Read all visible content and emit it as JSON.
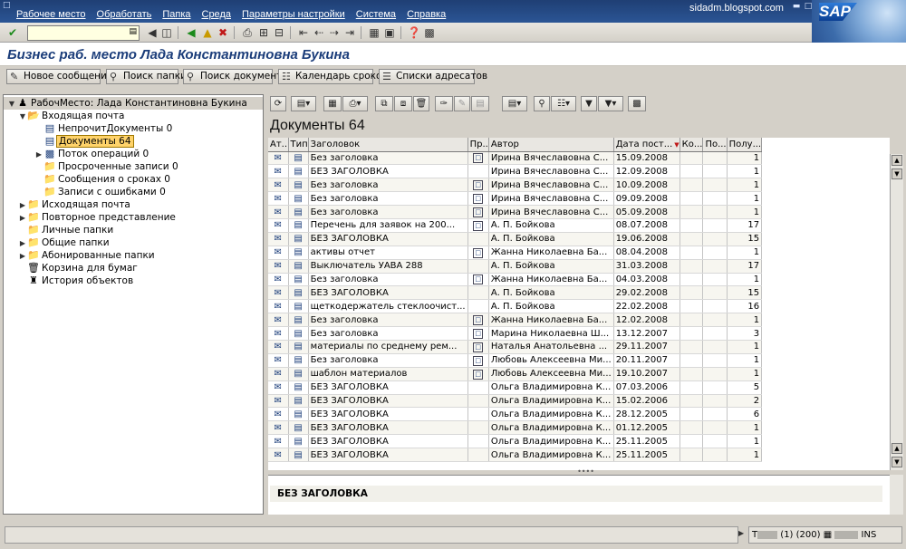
{
  "menu": {
    "items": [
      "Рабочее место",
      "Обработать",
      "Папка",
      "Среда",
      "Параметры настройки",
      "Система",
      "Справка"
    ],
    "blog_label": "sidadm.blogspot.com",
    "logo_text": "SAP"
  },
  "page": {
    "title": "Бизнес раб. место Лада Константиновна Букина"
  },
  "app_toolbar": [
    {
      "label": "Новое сообщение",
      "icon": "new-message-icon"
    },
    {
      "label": "Поиск папки",
      "icon": "search-icon"
    },
    {
      "label": "Поиск документа",
      "icon": "search-icon"
    },
    {
      "label": "Календарь сроков",
      "icon": "calendar-icon"
    },
    {
      "label": "Списки адресатов",
      "icon": "address-list-icon"
    }
  ],
  "tree": {
    "root": "РабочМесто: Лада Константиновна Букина",
    "nodes": [
      {
        "label": "Входящая почта"
      },
      {
        "label": "НепрочитДокументы 0"
      },
      {
        "label": "Документы 64"
      },
      {
        "label": "Поток операций 0"
      },
      {
        "label": "Просроченные записи 0"
      },
      {
        "label": "Сообщения о сроках 0"
      },
      {
        "label": "Записи с ошибками 0"
      },
      {
        "label": "Исходящая почта"
      },
      {
        "label": "Повторное представление"
      },
      {
        "label": "Личные папки"
      },
      {
        "label": "Общие папки"
      },
      {
        "label": "Абонированные папки"
      },
      {
        "label": "Корзина для бумаг"
      },
      {
        "label": "История объектов"
      }
    ]
  },
  "list": {
    "title": "Документы 64",
    "columns": [
      "Ат..",
      "Тип",
      "Заголовок",
      "Пр..",
      "Автор",
      "Дата пост...",
      "Ко...",
      "По...",
      "Полу..."
    ],
    "rows": [
      {
        "title": "Без заголовка",
        "author": "Ирина Вячеславовна С...",
        "date": "15.09.2008",
        "recv": "1",
        "pri": true
      },
      {
        "title": "БЕЗ ЗАГОЛОВКА",
        "author": "Ирина Вячеславовна С...",
        "date": "12.09.2008",
        "recv": "1",
        "pri": false
      },
      {
        "title": "Без заголовка",
        "author": "Ирина Вячеславовна С...",
        "date": "10.09.2008",
        "recv": "1",
        "pri": true
      },
      {
        "title": "Без заголовка",
        "author": "Ирина Вячеславовна С...",
        "date": "09.09.2008",
        "recv": "1",
        "pri": true
      },
      {
        "title": "Без заголовка",
        "author": "Ирина Вячеславовна С...",
        "date": "05.09.2008",
        "recv": "1",
        "pri": true
      },
      {
        "title": "Перечень для заявок на 200...",
        "author": "А. П. Бойкова",
        "date": "08.07.2008",
        "recv": "17",
        "pri": true
      },
      {
        "title": "БЕЗ ЗАГОЛОВКА",
        "author": "А. П. Бойкова",
        "date": "19.06.2008",
        "recv": "15",
        "pri": false
      },
      {
        "title": "активы отчет",
        "author": "Жанна Николаевна Ба...",
        "date": "08.04.2008",
        "recv": "1",
        "pri": true
      },
      {
        "title": "Выключатель УАВА 288",
        "author": "А. П. Бойкова",
        "date": "31.03.2008",
        "recv": "17",
        "pri": false
      },
      {
        "title": "Без заголовка",
        "author": "Жанна Николаевна Ба...",
        "date": "04.03.2008",
        "recv": "1",
        "pri": true
      },
      {
        "title": "БЕЗ ЗАГОЛОВКА",
        "author": "А. П. Бойкова",
        "date": "29.02.2008",
        "recv": "15",
        "pri": false
      },
      {
        "title": "щеткодержатель стеклоочист...",
        "author": "А. П. Бойкова",
        "date": "22.02.2008",
        "recv": "16",
        "pri": false
      },
      {
        "title": "Без заголовка",
        "author": "Жанна Николаевна Ба...",
        "date": "12.02.2008",
        "recv": "1",
        "pri": true
      },
      {
        "title": "Без заголовка",
        "author": "Марина Николаевна Ш...",
        "date": "13.12.2007",
        "recv": "3",
        "pri": true
      },
      {
        "title": "материалы по среднему рем...",
        "author": "Наталья Анатольевна ...",
        "date": "29.11.2007",
        "recv": "1",
        "pri": true
      },
      {
        "title": "Без заголовка",
        "author": "Любовь Алексеевна Ми...",
        "date": "20.11.2007",
        "recv": "1",
        "pri": true
      },
      {
        "title": "шаблон материалов",
        "author": "Любовь Алексеевна Ми...",
        "date": "19.10.2007",
        "recv": "1",
        "pri": true
      },
      {
        "title": "БЕЗ ЗАГОЛОВКА",
        "author": "Ольга Владимировна К...",
        "date": "07.03.2006",
        "recv": "5",
        "pri": false
      },
      {
        "title": "БЕЗ ЗАГОЛОВКА",
        "author": "Ольга Владимировна К...",
        "date": "15.02.2006",
        "recv": "2",
        "pri": false
      },
      {
        "title": "БЕЗ ЗАГОЛОВКА",
        "author": "Ольга Владимировна К...",
        "date": "28.12.2005",
        "recv": "6",
        "pri": false
      },
      {
        "title": "БЕЗ ЗАГОЛОВКА",
        "author": "Ольга Владимировна К...",
        "date": "01.12.2005",
        "recv": "1",
        "pri": false
      },
      {
        "title": "БЕЗ ЗАГОЛОВКА",
        "author": "Ольга Владимировна К...",
        "date": "25.11.2005",
        "recv": "1",
        "pri": false
      },
      {
        "title": "БЕЗ ЗАГОЛОВКА",
        "author": "Ольга Владимировна К...",
        "date": "25.11.2005",
        "recv": "1",
        "pri": false
      }
    ]
  },
  "preview": {
    "text": "БЕЗ ЗАГОЛОВКА"
  },
  "status": {
    "session_prefix": "T",
    "session_suffix": "(1) (200)",
    "mode": "INS"
  }
}
